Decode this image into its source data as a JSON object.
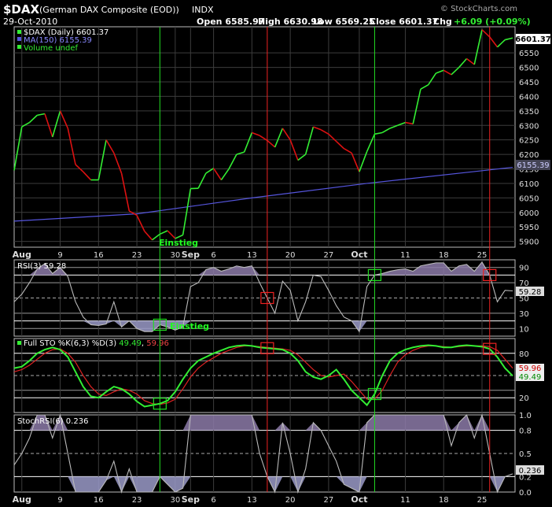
{
  "header": {
    "symbol": "$DAX",
    "name": "(German DAX Composite (EOD))",
    "exchange": "INDX",
    "date": "29-Oct-2010",
    "open": "Open 6585.97",
    "high": "High 6630.98",
    "low": "Low 6569.25",
    "close": "Close 6601.37",
    "chg_label": "Chg",
    "chg": "+6.09 (+0.09%)",
    "watermark": "© StockCharts.com"
  },
  "colors": {
    "up": "#33ee33",
    "down": "#dd1111",
    "ma": "#5555dd",
    "grid": "#3c3c3c",
    "frame": "#bbbbbb",
    "fill": "#8c7aa8",
    "fillLow": "#9a9ac8",
    "indicatorLine": "#bbbbbb",
    "signalLine": "#dd2222",
    "greenMarker": "#22dd22",
    "redMarker": "#ee2222"
  },
  "chart_data": [
    {
      "type": "line",
      "title": "$DAX (Daily) 6601.37",
      "series": [
        {
          "name": "$DAX (Daily) 6601.37",
          "x": [
            "2010-07-30",
            "2010-08-02",
            "2010-08-03",
            "2010-08-04",
            "2010-08-05",
            "2010-08-06",
            "2010-08-09",
            "2010-08-10",
            "2010-08-11",
            "2010-08-12",
            "2010-08-13",
            "2010-08-16",
            "2010-08-17",
            "2010-08-18",
            "2010-08-19",
            "2010-08-20",
            "2010-08-23",
            "2010-08-24",
            "2010-08-25",
            "2010-08-26",
            "2010-08-27",
            "2010-08-30",
            "2010-08-31",
            "2010-09-01",
            "2010-09-02",
            "2010-09-03",
            "2010-09-06",
            "2010-09-07",
            "2010-09-08",
            "2010-09-09",
            "2010-09-10",
            "2010-09-13",
            "2010-09-14",
            "2010-09-15",
            "2010-09-16",
            "2010-09-17",
            "2010-09-20",
            "2010-09-21",
            "2010-09-22",
            "2010-09-23",
            "2010-09-24",
            "2010-09-27",
            "2010-09-28",
            "2010-09-29",
            "2010-09-30",
            "2010-10-01",
            "2010-10-04",
            "2010-10-05",
            "2010-10-06",
            "2010-10-07",
            "2010-10-08",
            "2010-10-11",
            "2010-10-12",
            "2010-10-13",
            "2010-10-14",
            "2010-10-15",
            "2010-10-18",
            "2010-10-19",
            "2010-10-20",
            "2010-10-21",
            "2010-10-22",
            "2010-10-25",
            "2010-10-26",
            "2010-10-27",
            "2010-10-28",
            "2010-10-29"
          ],
          "values": [
            6145,
            6295,
            6310,
            6335,
            6340,
            6260,
            6350,
            6290,
            6165,
            6140,
            6112,
            6112,
            6250,
            6205,
            6135,
            6005,
            5990,
            5935,
            5905,
            5925,
            5937,
            5910,
            5922,
            6082,
            6083,
            6135,
            6152,
            6112,
            6150,
            6200,
            6208,
            6275,
            6265,
            6248,
            6225,
            6290,
            6250,
            6180,
            6200,
            6295,
            6285,
            6270,
            6245,
            6220,
            6205,
            6140,
            6210,
            6270,
            6275,
            6290,
            6300,
            6310,
            6305,
            6425,
            6440,
            6480,
            6490,
            6475,
            6500,
            6530,
            6510,
            6630,
            6605,
            6570,
            6595,
            6601.37
          ]
        },
        {
          "name": "MA(150) 6155.39",
          "x": [
            "2010-07-30",
            "2010-08-23",
            "2010-09-13",
            "2010-10-04",
            "2010-10-29"
          ],
          "values": [
            5970,
            5995,
            6050,
            6100,
            6155.39
          ]
        }
      ],
      "legend": [
        "$DAX (Daily) 6601.37",
        "MA(150) 6155.39",
        "Volume undef"
      ],
      "ylim": [
        5880,
        6640
      ],
      "yticks": [
        "6550",
        "6500",
        "6450",
        "6400",
        "6350",
        "6300",
        "6250",
        "6200",
        "6150",
        "6100",
        "6050",
        "6000",
        "5950",
        "5900"
      ],
      "last_label": "6601.37",
      "ma_label": "6155.39",
      "annotation": "Einstieg"
    },
    {
      "type": "area",
      "title": "RSI(3) 59.28",
      "values": [
        45,
        55,
        70,
        88,
        95,
        82,
        90,
        78,
        45,
        25,
        15,
        14,
        16,
        45,
        12,
        20,
        10,
        6,
        6,
        15,
        12,
        8,
        12,
        65,
        70,
        87,
        90,
        85,
        88,
        92,
        90,
        92,
        70,
        50,
        30,
        72,
        60,
        20,
        45,
        80,
        78,
        60,
        40,
        25,
        20,
        6,
        65,
        80,
        82,
        85,
        87,
        88,
        85,
        92,
        94,
        96,
        96,
        85,
        92,
        94,
        85,
        97,
        80,
        45,
        60,
        59.28
      ],
      "ylim": [
        0,
        100
      ],
      "yticks": [
        "90",
        "70",
        "50",
        "30",
        "10"
      ],
      "last_label": "59.28",
      "annotation": "Einstieg"
    },
    {
      "type": "line",
      "title": "Full STO %K(6,3) %D(3) 49.49, 59.96",
      "series": [
        {
          "name": "%K(6,3) 49.49",
          "values": [
            60,
            62,
            70,
            80,
            85,
            88,
            85,
            75,
            55,
            35,
            22,
            20,
            28,
            35,
            32,
            25,
            15,
            8,
            10,
            12,
            16,
            28,
            45,
            60,
            70,
            75,
            80,
            84,
            88,
            90,
            91,
            90,
            88,
            87,
            86,
            85,
            80,
            70,
            55,
            48,
            45,
            50,
            58,
            45,
            30,
            20,
            10,
            25,
            50,
            70,
            80,
            85,
            88,
            90,
            91,
            90,
            88,
            88,
            90,
            91,
            90,
            89,
            86,
            75,
            60,
            49.49
          ]
        },
        {
          "name": "%D(3) 59.96",
          "values": [
            55,
            58,
            64,
            72,
            80,
            85,
            86,
            80,
            68,
            50,
            35,
            25,
            23,
            28,
            32,
            30,
            25,
            16,
            12,
            11,
            13,
            18,
            32,
            48,
            60,
            68,
            74,
            80,
            84,
            88,
            90,
            90,
            89,
            88,
            87,
            86,
            84,
            78,
            68,
            58,
            50,
            48,
            50,
            52,
            42,
            30,
            18,
            18,
            30,
            50,
            68,
            78,
            84,
            88,
            90,
            90,
            89,
            88,
            89,
            90,
            90,
            90,
            89,
            84,
            72,
            59.96
          ]
        }
      ],
      "ylim": [
        0,
        100
      ],
      "yticks": [
        "80",
        "50",
        "20"
      ],
      "last_labels": [
        "59.96",
        "49.49"
      ]
    },
    {
      "type": "area",
      "title": "StochRSI(6) 0.236",
      "values": [
        0.35,
        0.5,
        0.7,
        1.0,
        1.0,
        0.7,
        1.0,
        0.5,
        0.0,
        0.0,
        0.0,
        0.0,
        0.15,
        0.4,
        0.0,
        0.3,
        0.0,
        0.0,
        0.0,
        0.2,
        0.1,
        0.0,
        0.05,
        1.0,
        1.0,
        1.0,
        1.0,
        1.0,
        1.0,
        1.0,
        1.0,
        1.0,
        0.5,
        0.2,
        0.0,
        0.9,
        0.5,
        0.0,
        0.3,
        0.9,
        0.8,
        0.6,
        0.4,
        0.1,
        0.05,
        0.0,
        0.9,
        1.0,
        1.0,
        1.0,
        1.0,
        1.0,
        1.0,
        1.0,
        1.0,
        1.0,
        1.0,
        0.6,
        0.9,
        1.0,
        0.7,
        1.0,
        0.5,
        0.0,
        0.2,
        0.236
      ],
      "ylim": [
        0,
        1
      ],
      "yticks": [
        "1.0",
        "0.8",
        "0.5",
        "0.2",
        "0.0"
      ],
      "last_label": "0.236"
    }
  ],
  "xaxis": {
    "labels": [
      {
        "text": "Aug",
        "i": 1,
        "bold": true
      },
      {
        "text": "9",
        "i": 6,
        "bold": false
      },
      {
        "text": "16",
        "i": 11,
        "bold": false
      },
      {
        "text": "23",
        "i": 16,
        "bold": false
      },
      {
        "text": "30",
        "i": 21,
        "bold": false
      },
      {
        "text": "Sep",
        "i": 23,
        "bold": true
      },
      {
        "text": "6",
        "i": 26,
        "bold": false
      },
      {
        "text": "13",
        "i": 31,
        "bold": false
      },
      {
        "text": "20",
        "i": 36,
        "bold": false
      },
      {
        "text": "27",
        "i": 41,
        "bold": false
      },
      {
        "text": "Oct",
        "i": 45,
        "bold": true
      },
      {
        "text": "11",
        "i": 51,
        "bold": false
      },
      {
        "text": "18",
        "i": 56,
        "bold": false
      },
      {
        "text": "25",
        "i": 61,
        "bold": false
      }
    ]
  },
  "markers": {
    "green": [
      19,
      47
    ],
    "red": [
      33,
      62
    ]
  }
}
